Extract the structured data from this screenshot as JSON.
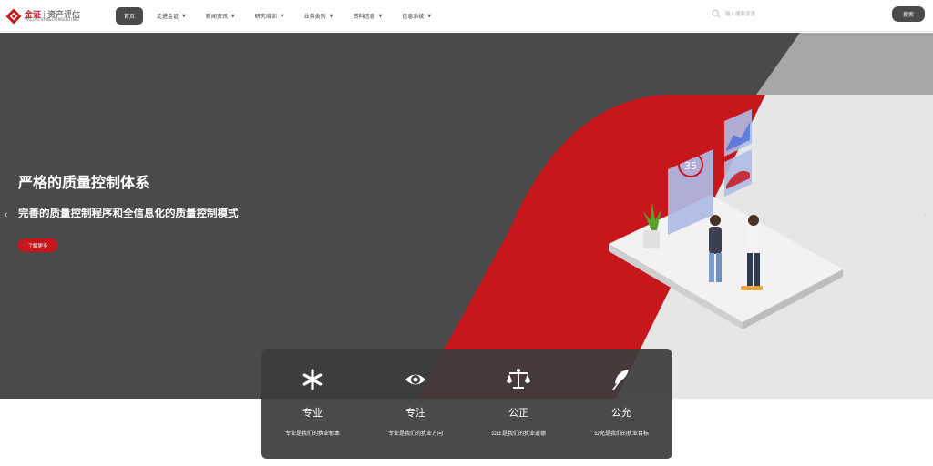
{
  "header": {
    "logo": {
      "brand": "金证",
      "divider": "|",
      "name": "资产评估",
      "english": "VALUATION&CONSULTING"
    },
    "nav": [
      {
        "label": "首页",
        "active": true,
        "has_dropdown": false
      },
      {
        "label": "走进金证",
        "active": false,
        "has_dropdown": true
      },
      {
        "label": "新闻资讯",
        "active": false,
        "has_dropdown": true
      },
      {
        "label": "研究培训",
        "active": false,
        "has_dropdown": true
      },
      {
        "label": "业务类别",
        "active": false,
        "has_dropdown": true
      },
      {
        "label": "资料信息",
        "active": false,
        "has_dropdown": true
      },
      {
        "label": "信息系统",
        "active": false,
        "has_dropdown": true
      }
    ],
    "search": {
      "placeholder": "输入搜索词语",
      "button_label": "搜索",
      "icon": "search-icon"
    }
  },
  "hero": {
    "title": "严格的质量控制体系",
    "subtitle": "完善的质量控制程序和全信息化的质量控制模式",
    "button_label": "了解更多",
    "prev_arrow": "‹",
    "next_arrow": "›",
    "illustration_number": "35",
    "colors": {
      "dark": "#4a4a4a",
      "red": "#c8161d",
      "light": "#e4e4e4"
    }
  },
  "values": [
    {
      "icon": "asterisk-icon",
      "title": "专业",
      "desc": "专业是我们的执业根本"
    },
    {
      "icon": "eye-icon",
      "title": "专注",
      "desc": "专业是我们的执业方向"
    },
    {
      "icon": "scale-icon",
      "title": "公正",
      "desc": "公正是我们的执业道德"
    },
    {
      "icon": "feather-icon",
      "title": "公允",
      "desc": "公允是我们的执业目标"
    }
  ]
}
